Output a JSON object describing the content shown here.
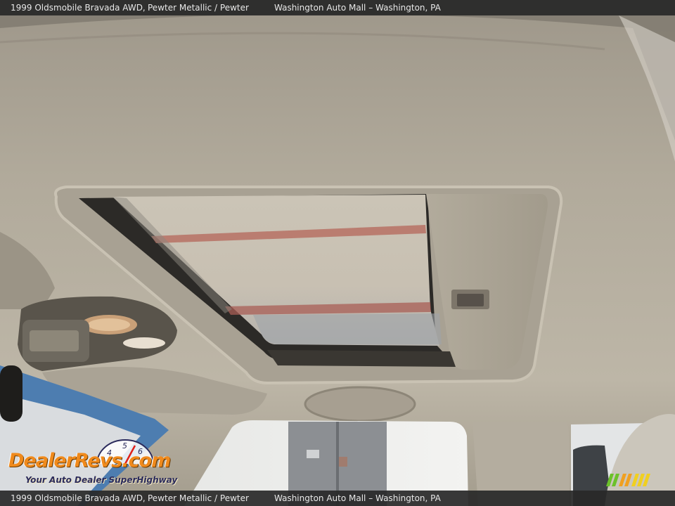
{
  "caption": {
    "vehicle": "1999 Oldsmobile Bravada AWD,",
    "color": "Pewter Metallic / Pewter",
    "dealer": "Washington Auto Mall – Washington, PA"
  },
  "watermark": {
    "brand": "DealerRevs.com",
    "tagline": "Your Auto Dealer SuperHighway",
    "gauge_numbers": [
      "4",
      "5",
      "6"
    ]
  },
  "colors": {
    "headliner": "#b3ab9b",
    "caption_bar": "#282828",
    "logo_orange": "#f08a1c",
    "logo_navy": "#2b2b5c",
    "stripe_green": "#6cc12a",
    "stripe_orange": "#f0a020",
    "stripe_yellow": "#f0d020"
  },
  "icons": [
    "dealerrevs-logo",
    "speed-gauge-icon",
    "color-stripes-icon"
  ]
}
